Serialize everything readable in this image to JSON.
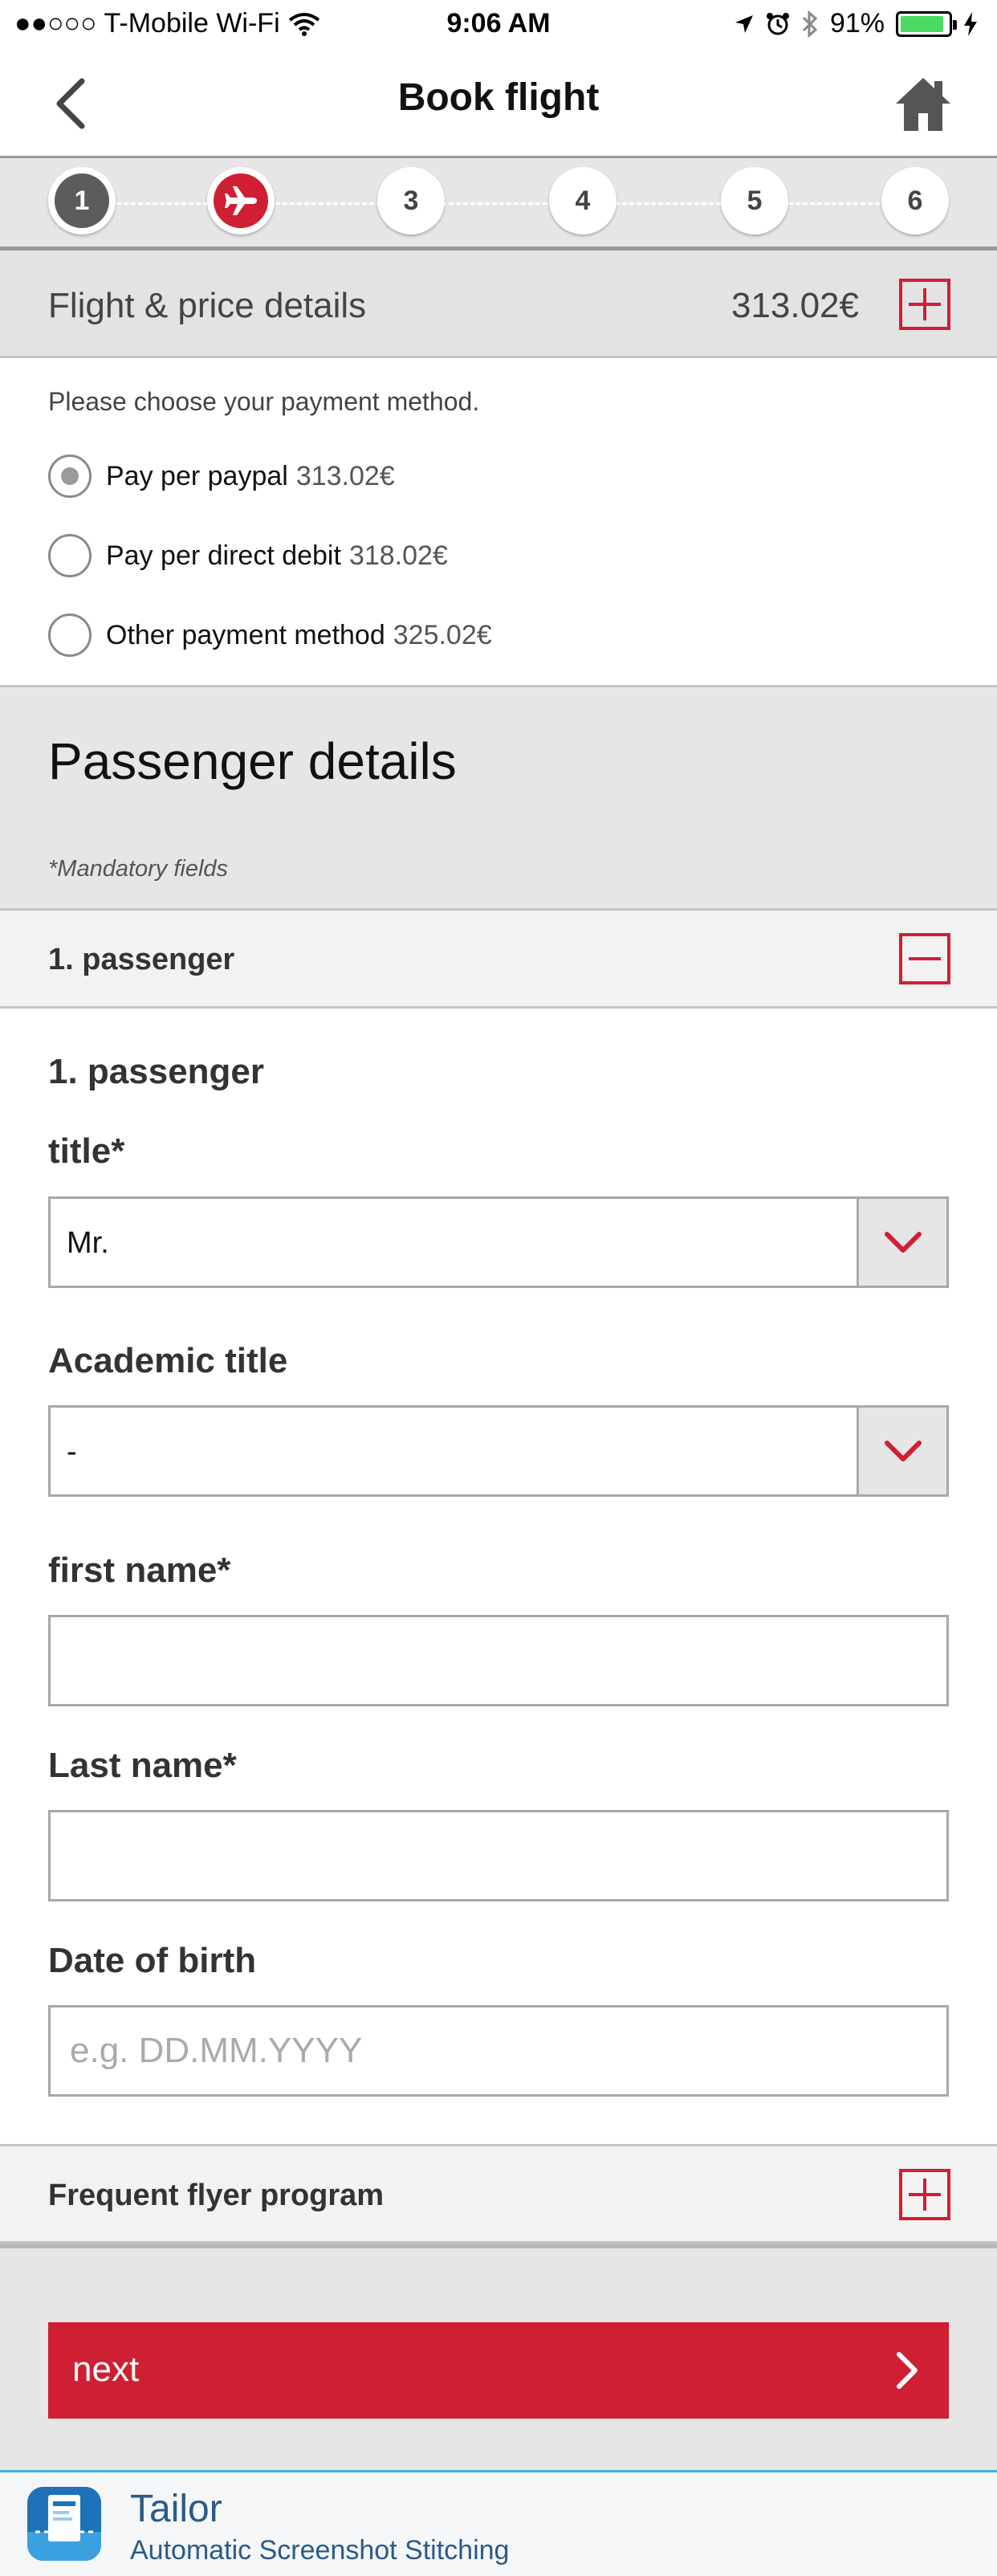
{
  "status_bar": {
    "signal_carrier": "●●○○○ T-Mobile Wi-Fi",
    "time": "9:06 AM",
    "battery_text": "91%",
    "battery_level": 0.91
  },
  "nav": {
    "title": "Book flight",
    "back_icon": "chevron-left-icon",
    "home_icon": "home-icon"
  },
  "stepper": {
    "steps": [
      {
        "label": "1",
        "state": "done"
      },
      {
        "label": "",
        "state": "active",
        "icon": "airplane-icon"
      },
      {
        "label": "3",
        "state": "upcoming"
      },
      {
        "label": "4",
        "state": "upcoming"
      },
      {
        "label": "5",
        "state": "upcoming"
      },
      {
        "label": "6",
        "state": "upcoming"
      }
    ]
  },
  "price_details": {
    "label": "Flight & price details",
    "amount": "313.02€",
    "expand_icon": "plus-icon"
  },
  "payment": {
    "prompt": "Please choose your payment method.",
    "options": [
      {
        "label": "Pay per paypal",
        "price": "313.02€",
        "selected": true
      },
      {
        "label": "Pay per direct debit",
        "price": "318.02€",
        "selected": false
      },
      {
        "label": "Other payment method",
        "price": "325.02€",
        "selected": false
      }
    ]
  },
  "passenger_details": {
    "title": "Passenger details",
    "mandatory_note": "*Mandatory fields",
    "accordion_label": "1. passenger",
    "collapse_icon": "minus-icon"
  },
  "form": {
    "heading": "1. passenger",
    "title_label": "title*",
    "title_value": "Mr.",
    "academic_label": "Academic title",
    "academic_value": "-",
    "first_name_label": "first name*",
    "first_name_value": "",
    "last_name_label": "Last name*",
    "last_name_value": "",
    "dob_label": "Date of birth",
    "dob_placeholder": "e.g. DD.MM.YYYY"
  },
  "frequent_flyer": {
    "label": "Frequent flyer program",
    "expand_icon": "plus-icon"
  },
  "next_button": {
    "label": "next"
  },
  "tailor": {
    "name": "Tailor",
    "tagline": "Automatic Screenshot Stitching"
  },
  "colors": {
    "accent": "#cf1f33",
    "panel_gray": "#e6e6e6"
  }
}
